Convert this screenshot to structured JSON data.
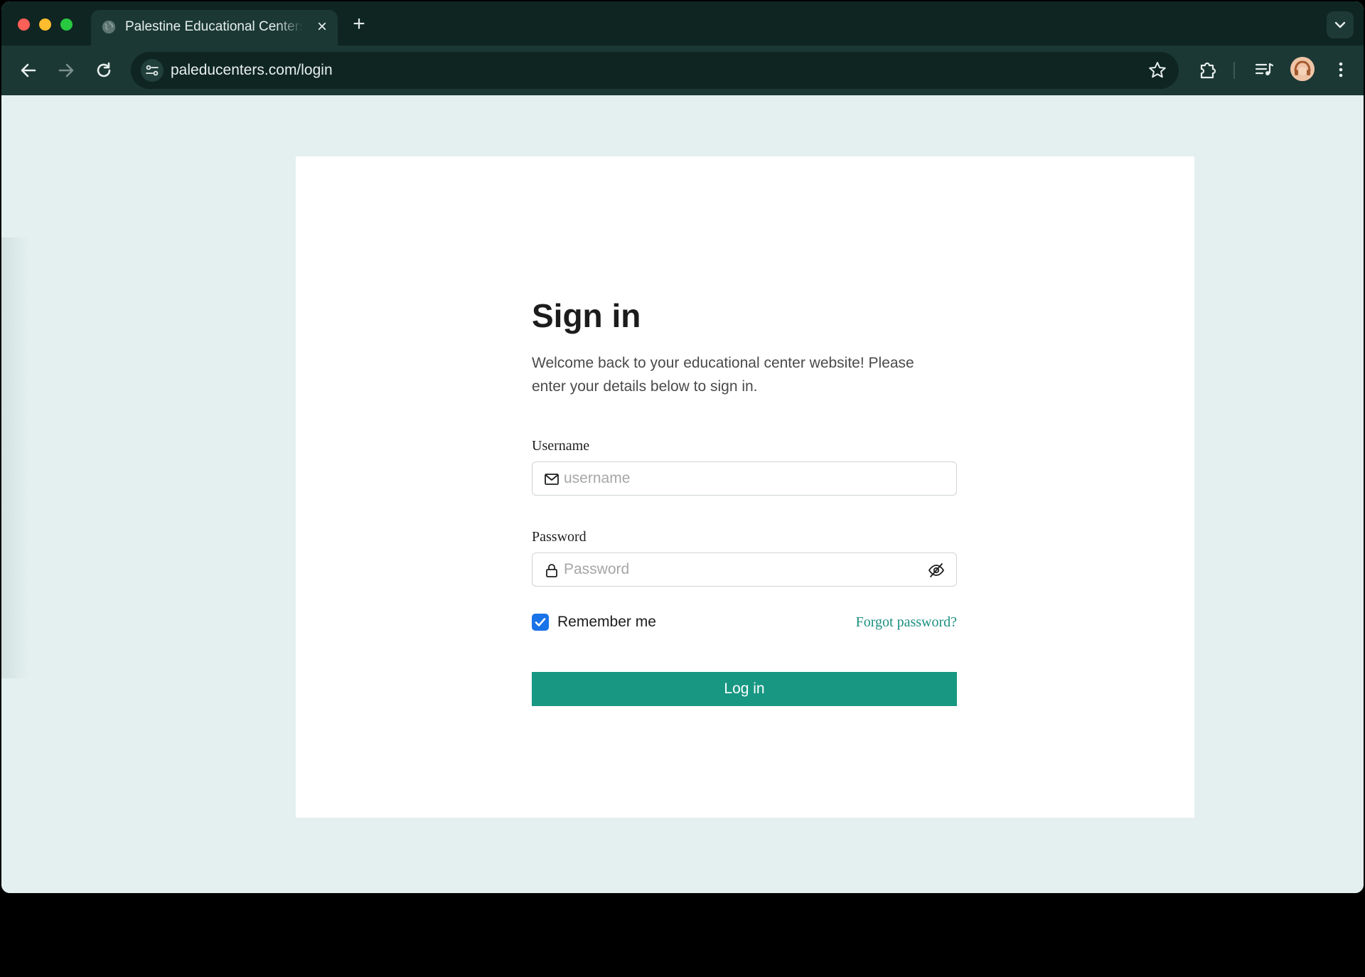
{
  "browser": {
    "tab_title": "Palestine Educational Centers",
    "url": "paleducenters.com/login",
    "icons": [
      "back-arrow-icon",
      "forward-arrow-icon",
      "reload-icon",
      "site-settings-icon",
      "star-icon",
      "extensions-icon",
      "media-controls-icon",
      "profile-avatar",
      "more-vert-icon"
    ]
  },
  "login": {
    "title": "Sign in",
    "subtitle": "Welcome back to your educational center website! Please enter your details below to sign in.",
    "username_label": "Username",
    "username_placeholder": "username",
    "password_label": "Password",
    "password_placeholder": "Password",
    "remember_label": "Remember me",
    "remember_checked": true,
    "forgot_label": "Forgot password?",
    "submit_label": "Log in"
  },
  "colors": {
    "accent": "#189783",
    "link": "#1b8f80",
    "checkbox": "#1a73e8",
    "page_bg": "#e3f0ef",
    "chrome_bg": "#1b3834"
  }
}
